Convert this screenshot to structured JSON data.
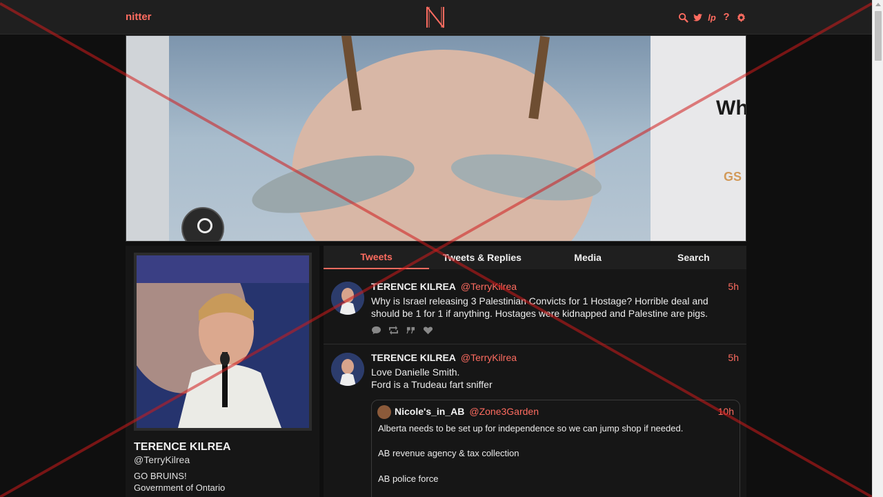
{
  "nav": {
    "brand": "nitter",
    "icons": [
      "search-icon",
      "twitter-bird-icon",
      "lp-icon",
      "help-icon",
      "gear-icon"
    ],
    "help_label": "?",
    "lp_label": "lp"
  },
  "profile": {
    "fullname": "TERENCE KILREA",
    "username": "@TerryKilrea",
    "bio_line1": "GO BRUINS!",
    "bio_line2": "Government of Ontario"
  },
  "tabs": [
    {
      "label": "Tweets",
      "active": true
    },
    {
      "label": "Tweets & Replies",
      "active": false
    },
    {
      "label": "Media",
      "active": false
    },
    {
      "label": "Search",
      "active": false
    }
  ],
  "tweets": [
    {
      "fullname": "TERENCE KILREA",
      "username": "@TerryKilrea",
      "date": "5h",
      "text": "Why is Israel releasing 3 Palestinian Convicts for 1 Hostage? Horrible deal and should be 1 for 1 if anything. Hostages were kidnapped and Palestine are pigs.",
      "stat_icons": [
        "comment-icon",
        "retweet-icon",
        "quote-icon",
        "heart-icon"
      ]
    },
    {
      "fullname": "TERENCE KILREA",
      "username": "@TerryKilrea",
      "date": "5h",
      "line1": "Love Danielle Smith.",
      "line2": "Ford is a Trudeau fart sniffer",
      "quote": {
        "fullname": "Nicole's_in_AB",
        "username": "@Zone3Garden",
        "date": "10h",
        "line1": "Alberta needs to be set up for independence so we can jump shop if needed.",
        "line2": "AB revenue agency & tax collection",
        "line3": "AB police force"
      }
    }
  ],
  "colors": {
    "accent": "#ff6c60",
    "background": "#0f0f0f",
    "panel": "#161616",
    "overlay_x": "#d01c1c"
  }
}
